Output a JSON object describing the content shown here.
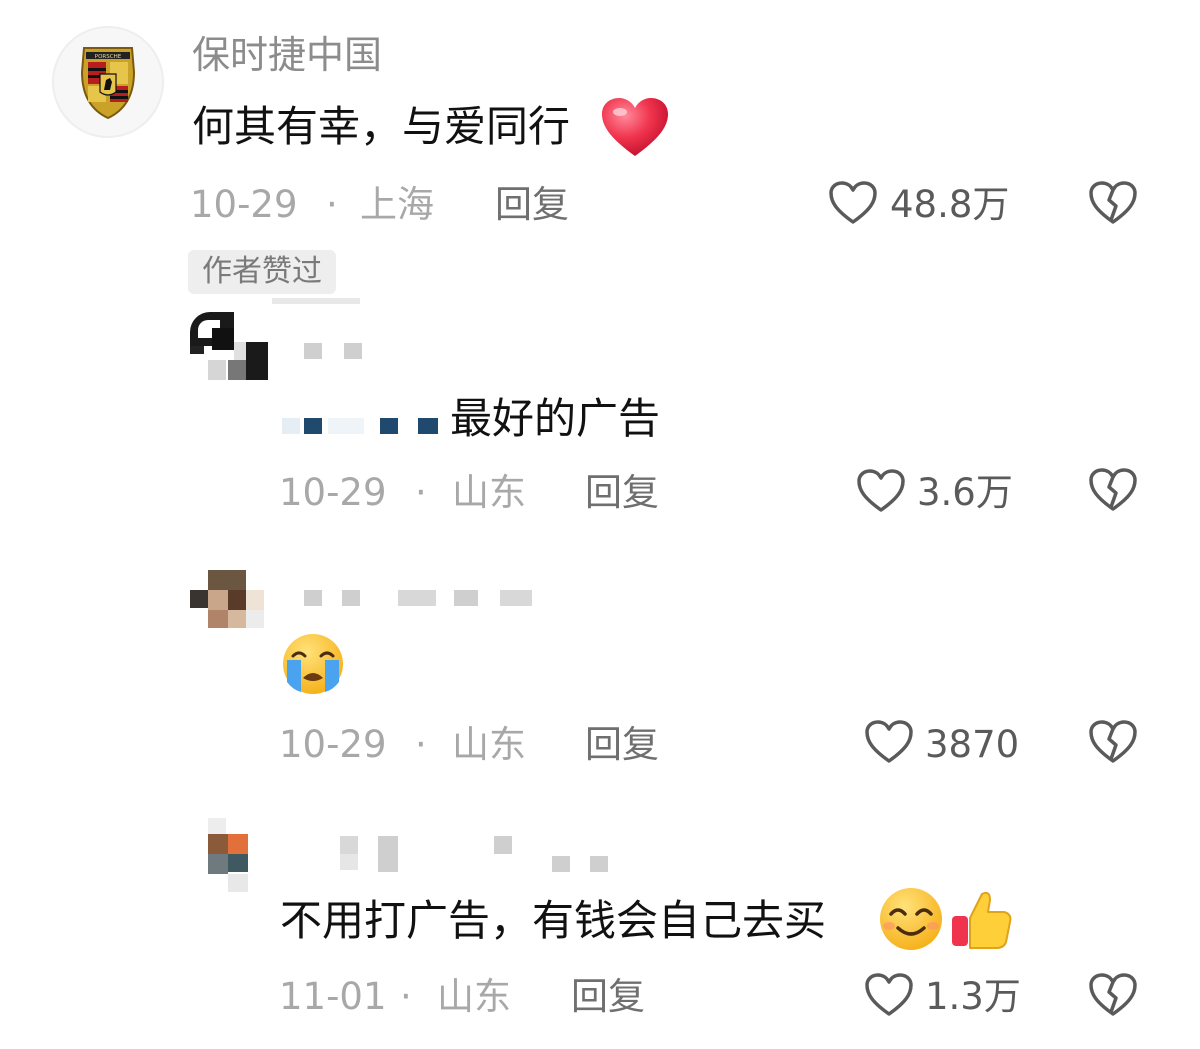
{
  "comments": [
    {
      "username": "保时捷中国",
      "text": "何其有幸，与爱同行",
      "date": "10-29",
      "location": "上海",
      "reply_label": "回复",
      "likes": "48.8万",
      "badge": "作者赞过"
    },
    {
      "username": "",
      "text": "最好的广告",
      "date": "10-29",
      "location": "山东",
      "reply_label": "回复",
      "likes": "3.6万"
    },
    {
      "username": "",
      "text": "",
      "date": "10-29",
      "location": "山东",
      "reply_label": "回复",
      "likes": "3870"
    },
    {
      "username": "",
      "text": "不用打广告，有钱会自己去买",
      "date": "11-01",
      "location": "山东",
      "reply_label": "回复",
      "likes": "1.3万"
    }
  ],
  "separator": "·",
  "logo_text": "PORSCHE",
  "icons": [
    "red-heart-emoji",
    "crying-face-emoji",
    "smiling-face-emoji",
    "thumbs-up-emoji",
    "heart-outline-icon",
    "broken-heart-icon"
  ],
  "colors": {
    "heart_red": "#f0344e",
    "meta_gray": "#a8a8a8",
    "icon_gray": "#5a5a5a"
  }
}
